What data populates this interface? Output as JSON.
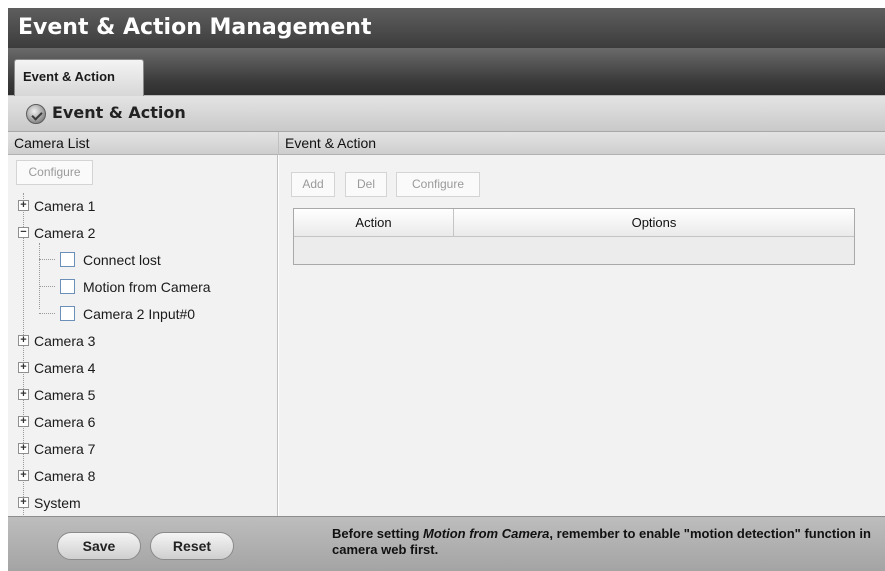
{
  "window": {
    "title": "Event & Action Management"
  },
  "tabs": [
    {
      "label": "Event & Action"
    }
  ],
  "section": {
    "title": "Event & Action",
    "icon": "gear-check-icon"
  },
  "camera_list": {
    "header": "Camera List",
    "configure_label": "Configure",
    "tree": [
      {
        "label": "Camera 1",
        "expanded": false
      },
      {
        "label": "Camera 2",
        "expanded": true,
        "children": [
          {
            "label": "Connect lost",
            "checked": false
          },
          {
            "label": "Motion from Camera",
            "checked": false
          },
          {
            "label": "Camera 2 Input#0",
            "checked": false
          }
        ]
      },
      {
        "label": "Camera 3",
        "expanded": false
      },
      {
        "label": "Camera 4",
        "expanded": false
      },
      {
        "label": "Camera 5",
        "expanded": false
      },
      {
        "label": "Camera 6",
        "expanded": false
      },
      {
        "label": "Camera 7",
        "expanded": false
      },
      {
        "label": "Camera 8",
        "expanded": false
      },
      {
        "label": "System",
        "expanded": false
      }
    ]
  },
  "event_action": {
    "header": "Event & Action",
    "add_label": "Add",
    "del_label": "Del",
    "configure_label": "Configure",
    "table": {
      "columns": [
        "Action",
        "Options"
      ],
      "rows": []
    }
  },
  "footer": {
    "save_label": "Save",
    "reset_label": "Reset",
    "note_before": "Before setting ",
    "note_emphasis": "Motion from Camera",
    "note_after": ", remember to enable \"motion detection\" function in camera web first."
  },
  "colors": {
    "title_bg": "#4a4a4a",
    "header_bg": "#d6d6d6",
    "footer_bg": "#b0b0b0",
    "checkbox_border": "#6c8fb8"
  }
}
